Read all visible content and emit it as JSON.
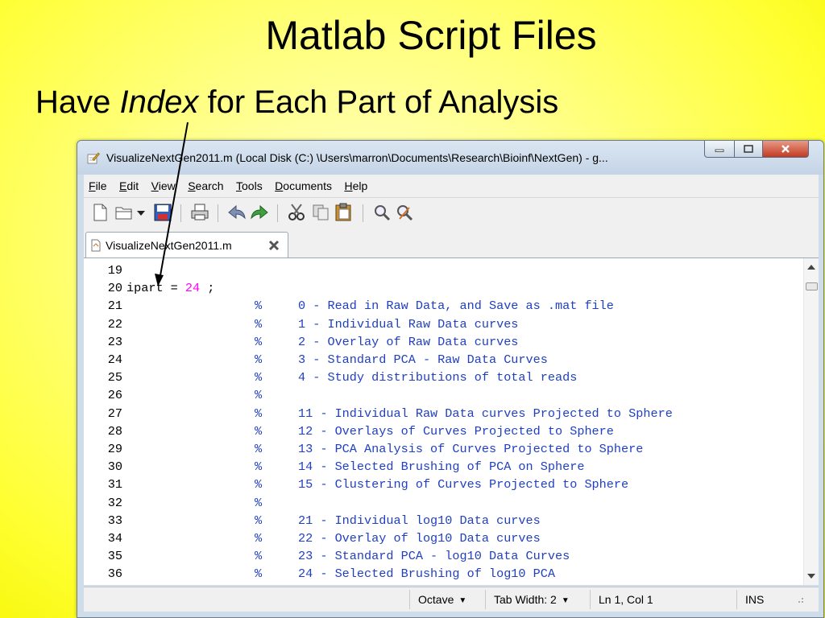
{
  "slide": {
    "title": "Matlab Script Files",
    "subtitle_prefix": "Have ",
    "subtitle_emphasis": "Index",
    "subtitle_suffix": " for Each Part of Analysis"
  },
  "window": {
    "title": "VisualizeNextGen2011.m (Local Disk (C:) \\Users\\marron\\Documents\\Research\\Bioinf\\NextGen) - g..."
  },
  "menu": {
    "file": {
      "u": "F",
      "rest": "ile"
    },
    "edit": {
      "u": "E",
      "rest": "dit"
    },
    "view": {
      "u": "V",
      "rest": "iew"
    },
    "search": {
      "u": "S",
      "rest": "earch"
    },
    "tools": {
      "u": "T",
      "rest": "ools"
    },
    "documents": {
      "u": "D",
      "rest": "ocuments"
    },
    "help": {
      "u": "H",
      "rest": "elp"
    }
  },
  "tab": {
    "label": "VisualizeNextGen2011.m"
  },
  "code": [
    {
      "ln": "19",
      "text": ""
    },
    {
      "ln": "20",
      "text": "ipart = ",
      "num": "24",
      "after": " ;"
    },
    {
      "ln": "21",
      "pct": "%",
      "comment": "0 - Read in Raw Data, and Save as .mat file"
    },
    {
      "ln": "22",
      "pct": "%",
      "comment": "1 - Individual Raw Data curves"
    },
    {
      "ln": "23",
      "pct": "%",
      "comment": "2 - Overlay of Raw Data curves"
    },
    {
      "ln": "24",
      "pct": "%",
      "comment": "3 - Standard PCA - Raw Data Curves"
    },
    {
      "ln": "25",
      "pct": "%",
      "comment": "4 - Study distributions of total reads"
    },
    {
      "ln": "26",
      "pct": "%",
      "comment": ""
    },
    {
      "ln": "27",
      "pct": "%",
      "comment": "11 - Individual Raw Data curves Projected to Sphere"
    },
    {
      "ln": "28",
      "pct": "%",
      "comment": "12 - Overlays of Curves Projected to Sphere"
    },
    {
      "ln": "29",
      "pct": "%",
      "comment": "13 - PCA Analysis of Curves Projected to Sphere"
    },
    {
      "ln": "30",
      "pct": "%",
      "comment": "14 - Selected Brushing of PCA on Sphere"
    },
    {
      "ln": "31",
      "pct": "%",
      "comment": "15 - Clustering of Curves Projected to Sphere"
    },
    {
      "ln": "32",
      "pct": "%",
      "comment": ""
    },
    {
      "ln": "33",
      "pct": "%",
      "comment": "21 - Individual log10 Data curves"
    },
    {
      "ln": "34",
      "pct": "%",
      "comment": "22 - Overlay of log10 Data curves"
    },
    {
      "ln": "35",
      "pct": "%",
      "comment": "23 - Standard PCA - log10 Data Curves"
    },
    {
      "ln": "36",
      "pct": "%",
      "comment": "24 - Selected Brushing of log10 PCA"
    }
  ],
  "status": {
    "language": "Octave",
    "tab_width": "Tab Width:  2",
    "position": "Ln 1, Col 1",
    "mode": "INS"
  },
  "colors": {
    "background": "#ffff33",
    "comment": "#2040c0",
    "number": "#ff00ff"
  }
}
